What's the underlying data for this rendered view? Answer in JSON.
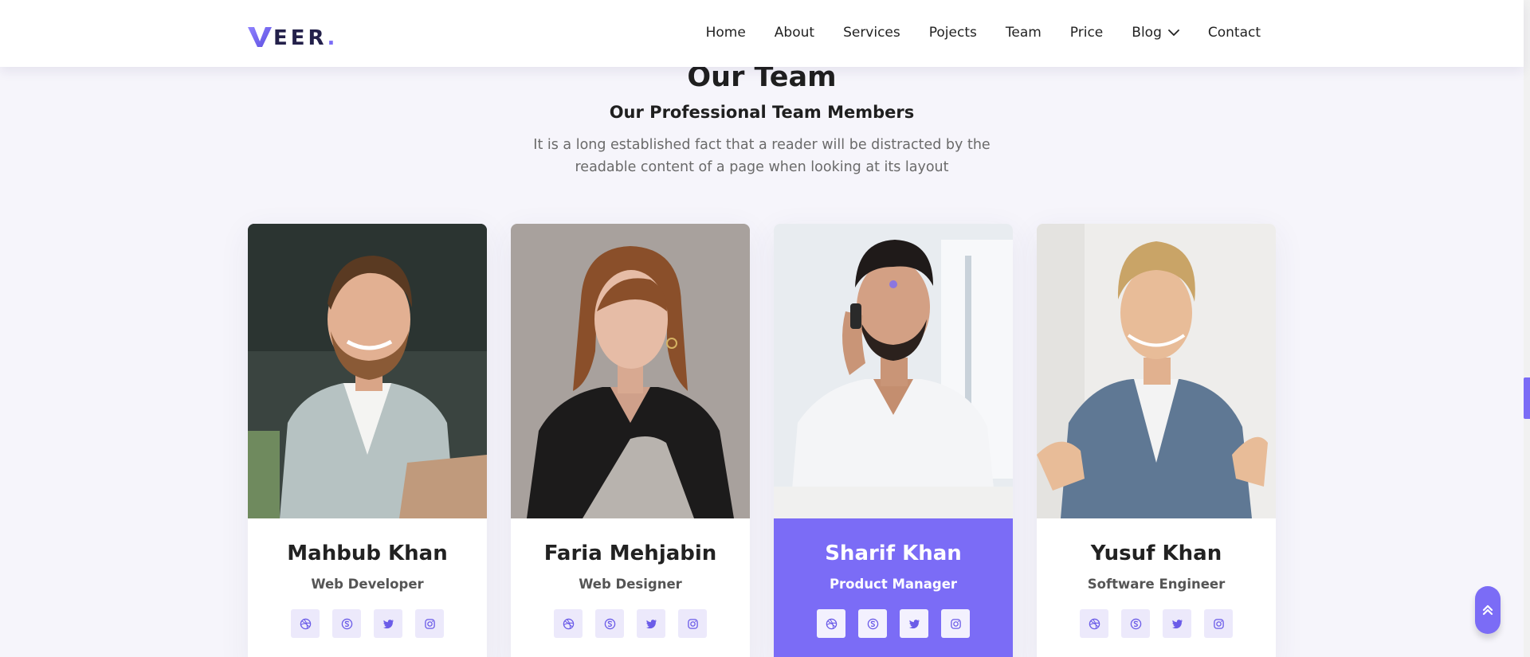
{
  "brand": {
    "name": "EER",
    "dot": ".",
    "accent": "#7b6cf6"
  },
  "nav": {
    "items": [
      {
        "label": "Home"
      },
      {
        "label": "About"
      },
      {
        "label": "Services"
      },
      {
        "label": "Pojects"
      },
      {
        "label": "Team"
      },
      {
        "label": "Price"
      },
      {
        "label": "Blog",
        "has_dropdown": true
      },
      {
        "label": "Contact"
      }
    ]
  },
  "section": {
    "title": "Our Team",
    "subtitle": "Our Professional Team Members",
    "description": "It is a long established fact that a reader will be distracted by the readable content of a page when looking at its layout"
  },
  "team": [
    {
      "name": "Mahbub Khan",
      "role": "Web Developer",
      "highlighted": false
    },
    {
      "name": "Faria Mehjabin",
      "role": "Web Designer",
      "highlighted": false
    },
    {
      "name": "Sharif Khan",
      "role": "Product Manager",
      "highlighted": true
    },
    {
      "name": "Yusuf Khan",
      "role": "Software Engineer",
      "highlighted": false
    }
  ],
  "social_icons": [
    "dribbble-icon",
    "skype-icon",
    "twitter-icon",
    "instagram-icon"
  ],
  "colors": {
    "accent": "#7b6cf6",
    "social_bg": "#ece9fb",
    "page_bg": "#f6f5fb"
  }
}
